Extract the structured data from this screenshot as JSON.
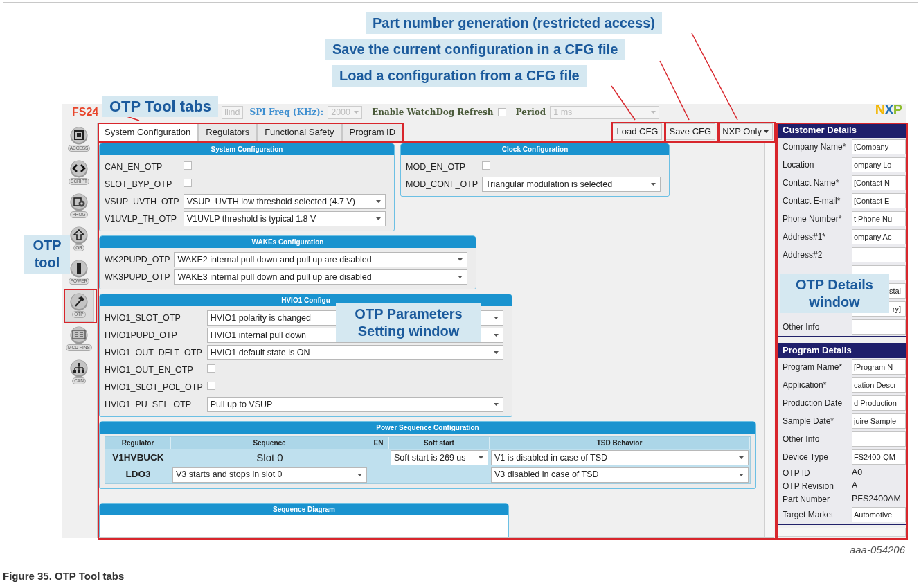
{
  "callouts": [
    {
      "text": "Part number generation (restricted access)"
    },
    {
      "text": "Save the current configuration in a CFG file"
    },
    {
      "text": "Load a configuration from a CFG file"
    },
    {
      "text": "OTP Tool tabs"
    },
    {
      "text": "OTP tool"
    },
    {
      "text": "OTP Parameters Setting window"
    },
    {
      "text": "OTP Details window"
    }
  ],
  "app": {
    "title": "FS24",
    "logo": "NXP",
    "toolbar": {
      "field_fragment": "llind",
      "spi_label": "SPI Freq (KHz):",
      "spi_value": "2000",
      "watchdog_label": "Enable WatchDog Refresh",
      "watchdog_checked": false,
      "period_label": "Period",
      "period_value": "1 ms"
    },
    "sidebar": [
      {
        "label": "ACCESS",
        "selected": false
      },
      {
        "label": "SCRIPT",
        "selected": false
      },
      {
        "label": "PROG",
        "selected": false
      },
      {
        "label": "OR",
        "selected": false
      },
      {
        "label": "POWER",
        "selected": false
      },
      {
        "label": "OTP",
        "selected": true
      },
      {
        "label": "MCU PINS",
        "selected": false
      },
      {
        "label": "CAN",
        "selected": false
      }
    ],
    "tabs": [
      {
        "label": "System Configuration",
        "selected": true
      },
      {
        "label": "Regulators",
        "selected": false
      },
      {
        "label": "Functional Safety",
        "selected": false
      },
      {
        "label": "Program ID",
        "selected": false
      }
    ],
    "buttons": [
      {
        "label": "Load CFG",
        "dropdown": false
      },
      {
        "label": "Save CFG",
        "dropdown": false
      },
      {
        "label": "NXP Only",
        "dropdown": true
      }
    ],
    "panels": [
      {
        "title": "System Configuration",
        "rows": [
          {
            "label": "CAN_EN_OTP",
            "kind": "checkbox",
            "checked": false
          },
          {
            "label": "SLOT_BYP_OTP",
            "kind": "checkbox",
            "checked": false
          },
          {
            "label": "VSUP_UVTH_OTP",
            "kind": "select",
            "value": "VSUP_UVTH low threshold selected (4.7 V)"
          },
          {
            "label": "V1UVLP_TH_OTP",
            "kind": "select",
            "value": "V1UVLP threshold is typical 1.8 V"
          }
        ]
      },
      {
        "title": "Clock Configuration",
        "rows": [
          {
            "label": "MOD_EN_OTP",
            "kind": "checkbox",
            "checked": false
          },
          {
            "label": "MOD_CONF_OTP",
            "kind": "select",
            "value": "Triangular modulation is selected"
          }
        ]
      },
      {
        "title": "WAKEs Configuration",
        "rows": [
          {
            "label": "WK2PUPD_OTP",
            "kind": "select",
            "value": "WAKE2 internal pull down and pull up are disabled"
          },
          {
            "label": "WK3PUPD_OTP",
            "kind": "select",
            "value": "WAKE3 internal pull down and pull up are disabled"
          }
        ]
      },
      {
        "title": "HVIO1 Configu",
        "rows": [
          {
            "label": "HVIO1_SLOT_OTP",
            "kind": "select",
            "value": "HVIO1 polarity is changed"
          },
          {
            "label": "HVIO1PUPD_OTP",
            "kind": "select",
            "value": "HVIO1 internal pull down"
          },
          {
            "label": "HVIO1_OUT_DFLT_OTP",
            "kind": "select",
            "value": "HVIO1 default state is ON"
          },
          {
            "label": "HVIO1_OUT_EN_OTP",
            "kind": "checkbox",
            "checked": false
          },
          {
            "label": "HVIO1_SLOT_POL_OTP",
            "kind": "checkbox",
            "checked": false
          },
          {
            "label": "HVIO1_PU_SEL_OTP",
            "kind": "select",
            "value": "Pull up to VSUP"
          }
        ]
      }
    ],
    "power_sequence": {
      "title": "Power Sequence Configuration",
      "columns": [
        "Regulator",
        "Sequence",
        "EN",
        "Soft start",
        "TSD Behavior"
      ],
      "rows": [
        {
          "cells": [
            {
              "kind": "label",
              "value": "V1HVBUCK"
            },
            {
              "kind": "text",
              "value": "Slot 0"
            },
            "",
            {
              "kind": "select",
              "value": "Soft start is 269 us"
            },
            {
              "kind": "select",
              "value": "V1 is disabled in case of TSD"
            }
          ]
        },
        {
          "cells": [
            {
              "kind": "label",
              "value": "LDO3"
            },
            {
              "kind": "select",
              "value": "V3 starts and stops in slot 0"
            },
            "",
            "",
            {
              "kind": "select",
              "value": "V3 disabled in case of TSD"
            }
          ]
        }
      ]
    },
    "sequence_diagram": {
      "title": "Sequence Diagram"
    },
    "customer_details": {
      "title": "Customer Details",
      "rows": [
        {
          "kind": "input",
          "label": "Company Name*",
          "value": "[Company"
        },
        {
          "kind": "input",
          "label": "Location",
          "value": "ompany Lo"
        },
        {
          "kind": "input",
          "label": "Contact Name*",
          "value": "[Contact N"
        },
        {
          "kind": "input",
          "label": "Contact E-mail*",
          "value": "[Contact E-"
        },
        {
          "kind": "input",
          "label": "Phone Number*",
          "value": "t Phone Nu"
        },
        {
          "kind": "input",
          "label": "Address#1*",
          "value": "ompany Ac"
        },
        {
          "kind": "input",
          "label": "Address#2"
        },
        {
          "kind": "input"
        },
        {
          "kind": "input",
          "value": "stal"
        },
        {
          "kind": "input",
          "value": "ry]"
        },
        {
          "kind": "input",
          "label": "Other Info"
        }
      ]
    },
    "program_details": {
      "title": "Program Details",
      "rows": [
        {
          "kind": "input",
          "label": "Program Name*",
          "value": "[Program N"
        },
        {
          "kind": "input",
          "label": "Application*",
          "value": "cation Descr"
        },
        {
          "kind": "input",
          "label": "Production Date",
          "value": "d Production"
        },
        {
          "kind": "input",
          "label": "Sample Date*",
          "value": "juire Sample"
        },
        {
          "kind": "input",
          "label": "Other Info"
        },
        {
          "kind": "input",
          "label": "Device Type",
          "value": "FS2400-QM"
        },
        {
          "kind": "text",
          "label": "OTP ID",
          "value": "A0"
        },
        {
          "kind": "text",
          "label": "OTP Revision",
          "value": "A"
        },
        {
          "kind": "text",
          "label": "Part Number",
          "value": "PFS2400AM"
        },
        {
          "kind": "input",
          "label": "Target Market",
          "value": "Automotive"
        }
      ]
    }
  },
  "figure": {
    "code": "aaa-054206",
    "caption": "Figure 35.  OTP Tool tabs"
  }
}
